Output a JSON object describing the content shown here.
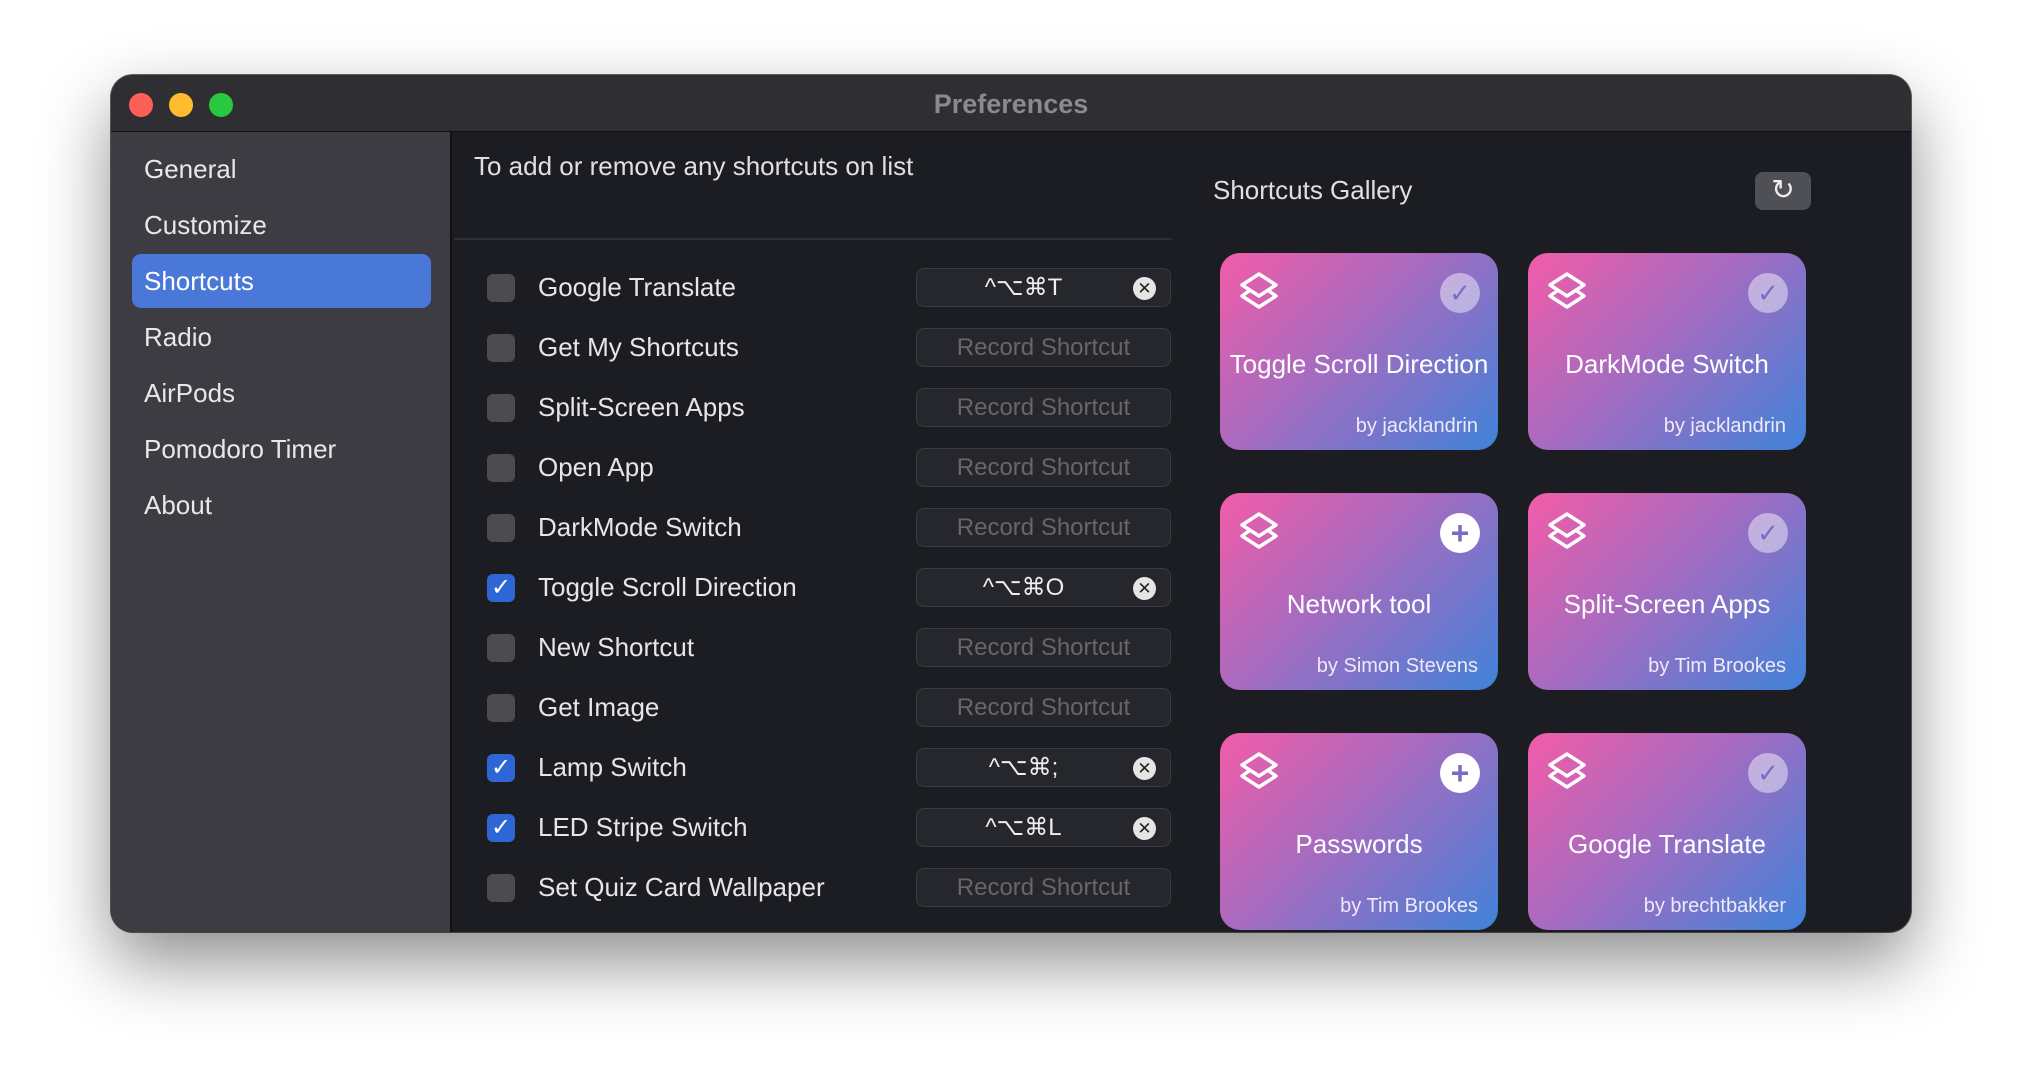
{
  "window": {
    "title": "Preferences"
  },
  "sidebar": {
    "items": [
      {
        "label": "General",
        "selected": false
      },
      {
        "label": "Customize",
        "selected": false
      },
      {
        "label": "Shortcuts",
        "selected": true
      },
      {
        "label": "Radio",
        "selected": false
      },
      {
        "label": "AirPods",
        "selected": false
      },
      {
        "label": "Pomodoro Timer",
        "selected": false
      },
      {
        "label": "About",
        "selected": false
      }
    ]
  },
  "shortcuts": {
    "header": "To add or remove any shortcuts on list",
    "record_placeholder": "Record Shortcut",
    "rows": [
      {
        "name": "Google Translate",
        "checked": false,
        "shortcut": "^⌥⌘T"
      },
      {
        "name": "Get My Shortcuts",
        "checked": false,
        "shortcut": ""
      },
      {
        "name": "Split-Screen Apps",
        "checked": false,
        "shortcut": ""
      },
      {
        "name": "Open App",
        "checked": false,
        "shortcut": ""
      },
      {
        "name": "DarkMode Switch",
        "checked": false,
        "shortcut": ""
      },
      {
        "name": "Toggle Scroll Direction",
        "checked": true,
        "shortcut": "^⌥⌘O"
      },
      {
        "name": "New Shortcut",
        "checked": false,
        "shortcut": ""
      },
      {
        "name": "Get Image",
        "checked": false,
        "shortcut": ""
      },
      {
        "name": "Lamp Switch",
        "checked": true,
        "shortcut": "^⌥⌘;"
      },
      {
        "name": "LED Stripe Switch",
        "checked": true,
        "shortcut": "^⌥⌘L"
      },
      {
        "name": "Set Quiz Card Wallpaper",
        "checked": false,
        "shortcut": ""
      }
    ]
  },
  "gallery": {
    "title": "Shortcuts Gallery",
    "refresh_icon": "refresh-icon",
    "cards": [
      {
        "name": "Toggle Scroll Direction",
        "author": "by jacklandrin",
        "status": "added"
      },
      {
        "name": "DarkMode Switch",
        "author": "by jacklandrin",
        "status": "added"
      },
      {
        "name": "Network tool",
        "author": "by Simon Stevens",
        "status": "add"
      },
      {
        "name": "Split-Screen Apps",
        "author": "by Tim Brookes",
        "status": "added"
      },
      {
        "name": "Passwords",
        "author": "by Tim Brookes",
        "status": "add"
      },
      {
        "name": "Google Translate",
        "author": "by brechtbakker",
        "status": "added"
      }
    ]
  },
  "colors": {
    "accent": "#4a78d8",
    "checkbox_on": "#2f66d6",
    "card_gradient": [
      "#f35ca8",
      "#3f83d9"
    ]
  }
}
